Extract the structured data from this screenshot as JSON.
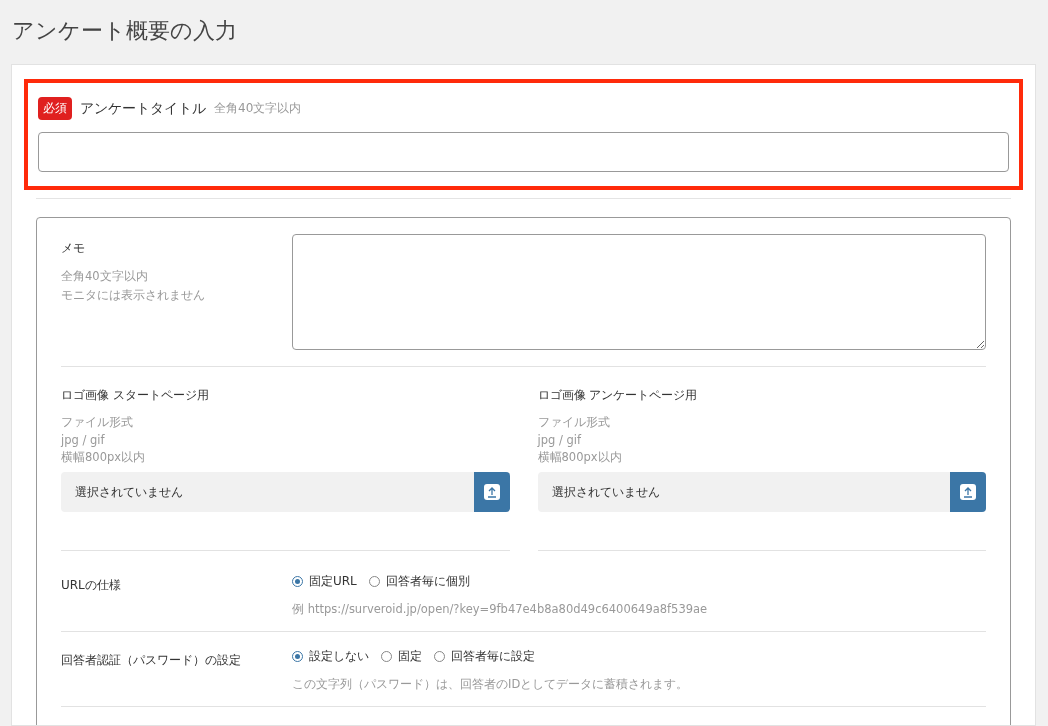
{
  "page_title": "アンケート概要の入力",
  "title_field": {
    "required_badge": "必須",
    "label": "アンケートタイトル",
    "hint": "全角40文字以内",
    "highlighted": true
  },
  "memo": {
    "label": "メモ",
    "hints": [
      "全角40文字以内",
      "モニタには表示されません"
    ]
  },
  "logos": [
    {
      "label": "ロゴ画像 スタートページ用",
      "hints": [
        "ファイル形式",
        "jpg / gif",
        "横幅800px以内"
      ],
      "file_status": "選択されていません"
    },
    {
      "label": "ロゴ画像 アンケートページ用",
      "hints": [
        "ファイル形式",
        "jpg / gif",
        "横幅800px以内"
      ],
      "file_status": "選択されていません"
    }
  ],
  "settings": [
    {
      "label": "URLの仕様",
      "options": [
        {
          "label": "固定URL",
          "selected": true
        },
        {
          "label": "回答者毎に個別",
          "selected": false
        }
      ],
      "note": "例 https://surveroid.jp/open/?key=9fb47e4b8a80d49c6400649a8f539ae"
    },
    {
      "label": "回答者認証（パスワード）の設定",
      "options": [
        {
          "label": "設定しない",
          "selected": true
        },
        {
          "label": "固定",
          "selected": false
        },
        {
          "label": "回答者毎に設定",
          "selected": false
        }
      ],
      "note": "この文字列（パスワード）は、回答者のIDとしてデータに蓄積されます。"
    }
  ]
}
